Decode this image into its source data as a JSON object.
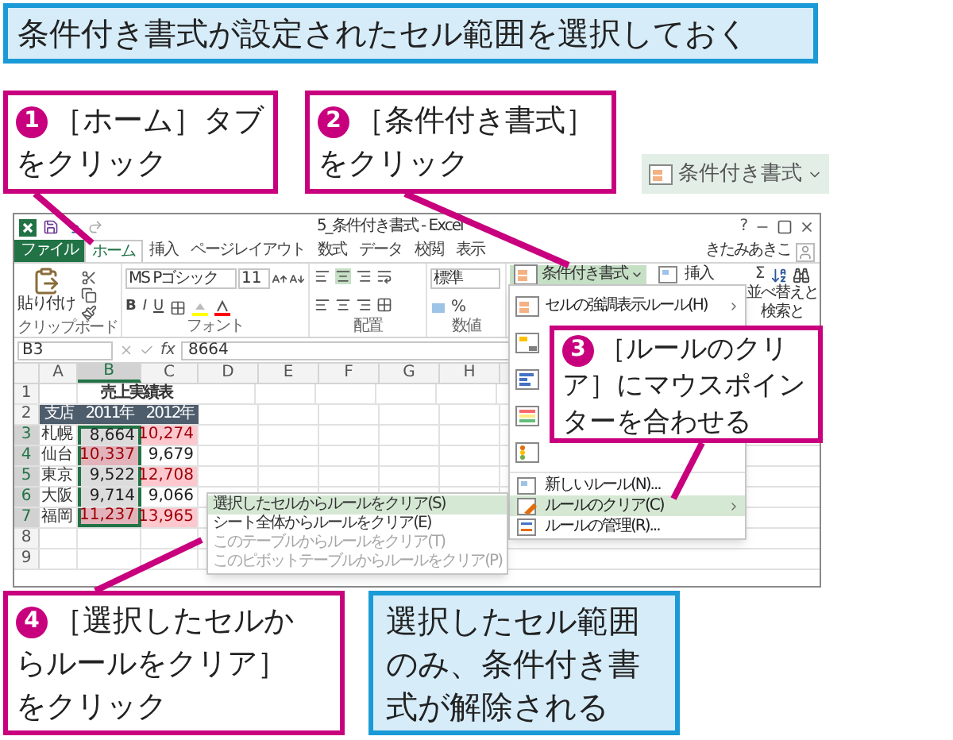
{
  "banner": {
    "text": "条件付き書式が設定されたセル範囲を選択しておく"
  },
  "steps": [
    {
      "number": "1",
      "lines": [
        "［ホーム］タブ",
        "をクリック"
      ]
    },
    {
      "number": "2",
      "lines": [
        "［条件付き書式］",
        "をクリック"
      ]
    },
    {
      "number": "3",
      "lines": [
        "［ルールのクリ",
        "ア］にマウスポイン",
        "ターを合わせる"
      ]
    },
    {
      "number": "4",
      "lines": [
        "［選択したセルか",
        "らルールをクリア］",
        "をクリック"
      ]
    }
  ],
  "button_sample": {
    "label": "条件付き書式"
  },
  "result": {
    "lines": [
      "選択したセル範囲",
      "のみ、条件付き書",
      "式が解除される"
    ]
  },
  "excel": {
    "title": "5_条件付き書式 - Excel",
    "help": "?",
    "user": "きたみあきこ",
    "tabs": [
      {
        "label": "ファイル",
        "kind": "file",
        "selected": false
      },
      {
        "label": "ホーム",
        "kind": "tab",
        "selected": true
      },
      {
        "label": "挿入",
        "kind": "tab",
        "selected": false
      },
      {
        "label": "ページレイアウト",
        "kind": "tab",
        "selected": false
      },
      {
        "label": "数式",
        "kind": "tab",
        "selected": false
      },
      {
        "label": "データ",
        "kind": "tab",
        "selected": false
      },
      {
        "label": "校閲",
        "kind": "tab",
        "selected": false
      },
      {
        "label": "表示",
        "kind": "tab",
        "selected": false
      }
    ],
    "ribbon": {
      "paste": "貼り付け",
      "font_name": "MS Pゴシック",
      "font_size": "11",
      "format_buttons": [
        "B",
        "I",
        "U"
      ],
      "number_format": "標準",
      "percent": "%",
      "group_labels": [
        "クリップボード",
        "フォント",
        "配置",
        "数値"
      ],
      "conditional_format": "条件付き書式",
      "insert": "挿入",
      "sum": "Σ",
      "sort": "並べ替えと",
      "find": "検索と"
    },
    "name_box": "B3",
    "function_label": "fx",
    "formula": "8664",
    "sheet": {
      "columns": [
        {
          "label": "A",
          "selected": false
        },
        {
          "label": "B",
          "selected": true
        },
        {
          "label": "C",
          "selected": false
        },
        {
          "label": "D",
          "selected": false
        },
        {
          "label": "E",
          "selected": false
        },
        {
          "label": "F",
          "selected": false
        },
        {
          "label": "G",
          "selected": false
        },
        {
          "label": "H",
          "selected": false
        }
      ],
      "rows": [
        {
          "number": "1",
          "kind": "title",
          "selected": false,
          "text": "売上実績表"
        },
        {
          "number": "2",
          "kind": "header",
          "selected": false,
          "cells": [
            "支店",
            "2011年",
            "2012年"
          ]
        },
        {
          "number": "3",
          "kind": "data",
          "selected": true,
          "branch": "札幌",
          "values": [
            {
              "text": "8,664",
              "highlight": false,
              "selected": true
            },
            {
              "text": "10,274",
              "highlight": true,
              "selected": false
            }
          ]
        },
        {
          "number": "4",
          "kind": "data",
          "selected": true,
          "branch": "仙台",
          "values": [
            {
              "text": "10,337",
              "highlight": true,
              "selected": true
            },
            {
              "text": "9,679",
              "highlight": false,
              "selected": false
            }
          ]
        },
        {
          "number": "5",
          "kind": "data",
          "selected": true,
          "branch": "東京",
          "values": [
            {
              "text": "9,522",
              "highlight": false,
              "selected": true
            },
            {
              "text": "12,708",
              "highlight": true,
              "selected": false
            }
          ]
        },
        {
          "number": "6",
          "kind": "data",
          "selected": true,
          "branch": "大阪",
          "values": [
            {
              "text": "9,714",
              "highlight": false,
              "selected": true
            },
            {
              "text": "9,066",
              "highlight": false,
              "selected": false
            }
          ]
        },
        {
          "number": "7",
          "kind": "data",
          "selected": true,
          "branch": "福岡",
          "values": [
            {
              "text": "11,237",
              "highlight": true,
              "selected": true
            },
            {
              "text": "13,965",
              "highlight": true,
              "selected": false
            }
          ]
        },
        {
          "number": "8",
          "kind": "blank",
          "selected": false
        },
        {
          "number": "9",
          "kind": "blank",
          "selected": false
        }
      ]
    },
    "menu": {
      "items": [
        {
          "kind": "highlight",
          "label": "セルの強調表示ルール(H)",
          "submenu": true,
          "selected": false
        },
        {
          "kind": "top-bottom",
          "selected": false
        },
        {
          "kind": "data-bar",
          "selected": false
        },
        {
          "kind": "color-scale",
          "selected": false
        },
        {
          "kind": "icon-set",
          "selected": false
        },
        {
          "kind": "new-rule",
          "label": "新しいルール(N)...",
          "selected": false
        },
        {
          "kind": "clear",
          "label": "ルールのクリア(C)",
          "submenu": true,
          "selected": true
        },
        {
          "kind": "manage",
          "label": "ルールの管理(R)...",
          "selected": false
        }
      ]
    },
    "submenu": {
      "items": [
        {
          "label": "選択したセルからルールをクリア(S)",
          "selected": true,
          "disabled": false
        },
        {
          "label": "シート全体からルールをクリア(E)",
          "selected": false,
          "disabled": false
        },
        {
          "label": "このテーブルからルールをクリア(T)",
          "selected": false,
          "disabled": true
        },
        {
          "label": "このピボットテーブルからルールをクリア(P)",
          "selected": false,
          "disabled": true
        }
      ]
    }
  }
}
